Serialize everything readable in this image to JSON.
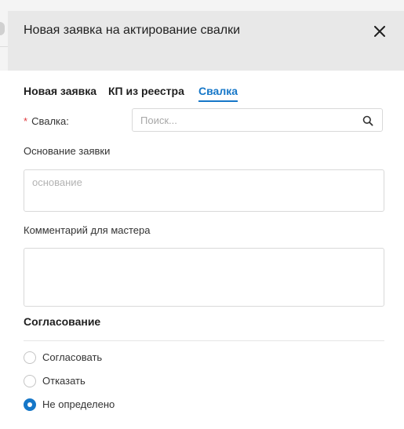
{
  "dialog": {
    "title": "Новая заявка на актирование свалки",
    "close_icon": "close-icon"
  },
  "tabs": [
    {
      "label": "Новая заявка",
      "active": false
    },
    {
      "label": "КП из реестра",
      "active": false
    },
    {
      "label": "Свалка",
      "active": true
    }
  ],
  "form": {
    "dump_field": {
      "required_marker": "*",
      "label": "Свалка:",
      "placeholder": "Поиск...",
      "value": "",
      "icon": "search-icon"
    },
    "basis": {
      "label": "Основание заявки",
      "placeholder": "основание",
      "value": ""
    },
    "master_comment": {
      "label": "Комментарий для мастера",
      "placeholder": "",
      "value": ""
    }
  },
  "approval": {
    "title": "Согласование",
    "options": [
      {
        "label": "Согласовать",
        "checked": false
      },
      {
        "label": "Отказать",
        "checked": false
      },
      {
        "label": "Не определено",
        "checked": true
      }
    ]
  },
  "colors": {
    "accent": "#1677c8",
    "required": "#e0393e",
    "header_bg": "#e8e8e8"
  }
}
